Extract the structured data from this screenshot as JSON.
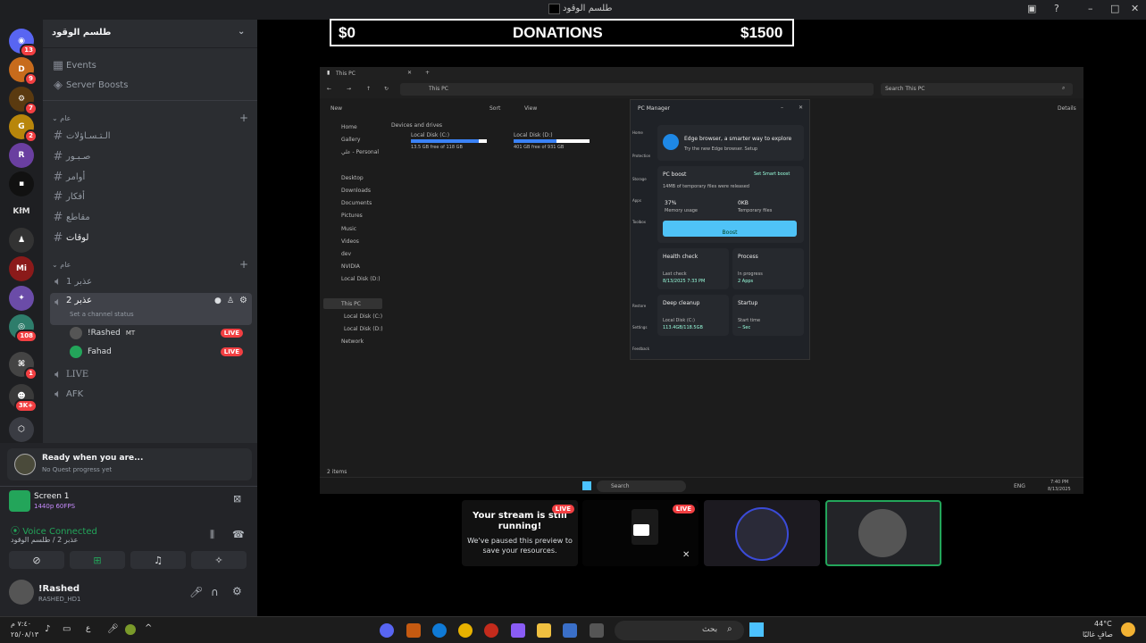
{
  "window_title": "طلسم الوقود",
  "server": {
    "name": "طلسم الوقود"
  },
  "guild_badges": [
    "13",
    "9",
    "7",
    "2",
    "108",
    "1",
    "3K+"
  ],
  "guild_letters": {
    "d": "D",
    "g": "G",
    "klm": "KłM",
    "mi": "Mi"
  },
  "categories": {
    "text": "عام",
    "voice": "عام"
  },
  "text_channels": [
    "الـتـسـاؤلات",
    "صـبـور",
    "أوامر",
    "أفكار",
    "مقاطع",
    "لوقات"
  ],
  "events_label": "Events",
  "boosts_label": "Server Boosts",
  "voice_channels": {
    "ch1": "عذبر 1",
    "ch2": "عذبر 2",
    "ch2_status": "Set a channel status",
    "ch3": "LIVE",
    "ch4": "AFK"
  },
  "voice_users": [
    {
      "name": "!Rashed",
      "tag": "MT",
      "live": "LIVE"
    },
    {
      "name": "Fahad",
      "live": "LIVE"
    }
  ],
  "quest": {
    "title": "Ready when you are...",
    "sub": "No Quest progress yet"
  },
  "screen": {
    "title": "Screen 1",
    "sub": "1440p 60FPS"
  },
  "voice": {
    "status": "Voice Connected",
    "where": "عذبر 2 / طلسم الوقود"
  },
  "user": {
    "name": "!Rashed",
    "tag": "RASHED_HD1"
  },
  "donations": {
    "left": "$0",
    "title": "DONATIONS",
    "right": "$1500"
  },
  "explorer": {
    "tab": "This PC",
    "crumb": "This PC",
    "search": "Search This PC",
    "new": "New",
    "sort": "Sort",
    "view": "View",
    "details": "Details",
    "section": "Devices and drives",
    "drives": [
      {
        "name": "Local Disk (C:)",
        "free": "13.5 GB free of 118 GB",
        "fill": 0.89
      },
      {
        "name": "Local Disk (D:)",
        "free": "401 GB free of 931 GB",
        "fill": 0.57
      }
    ],
    "nav": [
      "Home",
      "Gallery",
      "علي - Personal",
      "Desktop",
      "Downloads",
      "Documents",
      "Pictures",
      "Music",
      "Videos",
      "dev",
      "NVIDIA",
      "Local Disk (D:)",
      "This PC",
      "Local Disk (C:)",
      "Local Disk (D:)",
      "Network"
    ],
    "status": "2 items"
  },
  "pcmanager": {
    "title": "PC Manager",
    "edge_title": "Edge browser, a smarter way to explore",
    "edge_sub": "Try the new Edge browser. Setup",
    "boost_title": "PC boost",
    "boost_link": "Set Smart boost",
    "boost_sub": "14MB of temporary files were released",
    "mem_val": "37%",
    "mem_label": "Memory usage",
    "tmp_val": "0KB",
    "tmp_label": "Temporary files",
    "boost_btn": "Boost",
    "health": "Health check",
    "health_sub1": "Last check",
    "health_sub2": "8/13/2025 7:33 PM",
    "process": "Process",
    "process_sub1": "In progress",
    "process_sub2": "2 Apps",
    "cleanup": "Deep cleanup",
    "cleanup_sub1": "Local Disk (C:)",
    "cleanup_sub2": "113.4GB/118.5GB",
    "startup": "Startup",
    "startup_sub1": "Start time",
    "startup_sub2": "-- Sec",
    "side": [
      "Home",
      "Protection",
      "Storage",
      "Apps",
      "Toolbox",
      "Restore",
      "Settings",
      "Feedback"
    ]
  },
  "inner_taskbar": {
    "search": "Search",
    "lang": "ENG",
    "time": "7:40 PM",
    "date": "8/13/2025"
  },
  "tiles": {
    "paused_title": "Your stream is still running!",
    "paused_sub": "We've paused this preview to save your resources.",
    "live": "LIVE"
  },
  "taskbar": {
    "search": "بحث",
    "time": "٧:٤٠ م",
    "date": "٢٥/٠٨/١٣",
    "lang": "ع",
    "temp": "44°C",
    "weather": "صافٍ غالبًا"
  },
  "colors": {
    "live": "#f23f42",
    "connected": "#23a55a",
    "boost": "#4fc3f7",
    "drive": "#3b82f6"
  }
}
